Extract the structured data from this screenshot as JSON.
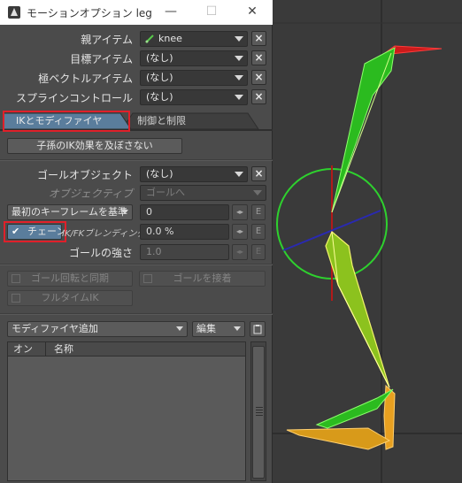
{
  "window": {
    "title": "モーションオプション leg",
    "minimize": "—",
    "maximize": "☐",
    "close": "✕"
  },
  "icons": {
    "app": "lightwave-icon",
    "item": "bone-icon",
    "close_x": "x-icon",
    "checkmark": "checkmark-icon",
    "clipboard": "clipboard-icon"
  },
  "fields": {
    "parent_item": {
      "label": "親アイテム",
      "value": "knee"
    },
    "target_item": {
      "label": "目標アイテム",
      "value": "(なし)"
    },
    "pole_vector": {
      "label": "極ベクトルアイテム",
      "value": "(なし)"
    },
    "spline_control": {
      "label": "スプラインコントロール",
      "value": "(なし)"
    }
  },
  "tabs": [
    {
      "label": "IKとモディファイヤ",
      "active": true
    },
    {
      "label": "制御と制限",
      "active": false
    }
  ],
  "ik_tab": {
    "children_no_ik": "子孫のIK効果を及ぼさない",
    "goal_object": {
      "label": "ゴールオブジェクト",
      "value": "(なし)"
    },
    "objective": {
      "label": "オブジェクティブ",
      "value": "ゴールへ"
    },
    "first_key_dropdown": "最初のキーフレームを基準",
    "first_key_value": "0",
    "chain_checkbox": {
      "label": "チェーン",
      "checked": true
    },
    "ikfk_blend": {
      "label": "IK/FKブレンディング",
      "value": "0.0 %"
    },
    "goal_strength": {
      "label": "ゴールの強さ",
      "value": "1.0"
    },
    "goal_rotation_sync": "ゴール回転と同期",
    "goal_connect": "ゴールを接着",
    "full_time_ik": "フルタイムIK",
    "envelope_button": "E"
  },
  "modifiers": {
    "add_dropdown": "モディファイヤ追加",
    "edit_dropdown": "編集",
    "columns": [
      "オン",
      "名称"
    ],
    "rows": []
  },
  "colors": {
    "accent_tab": "#5a7d9c",
    "highlight_red": "#e0202a",
    "bone_green": "#33cc22",
    "bone_yellow": "#e8e850",
    "bone_orange": "#e8a020",
    "goal_circle": "#2ed12e"
  }
}
